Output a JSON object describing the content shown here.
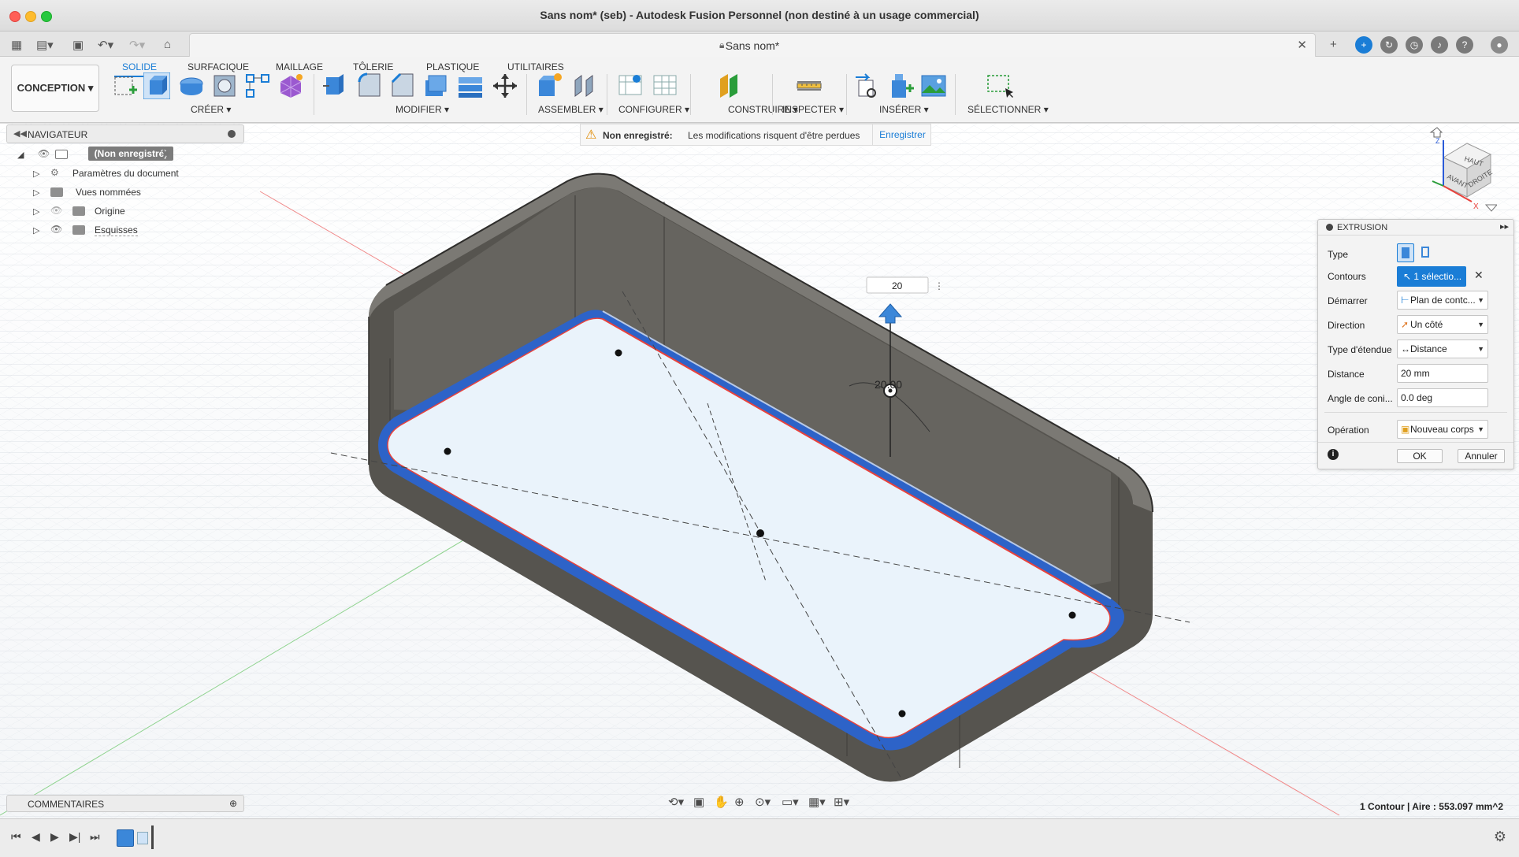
{
  "window": {
    "title": "Sans nom* (seb) - Autodesk Fusion Personnel (non destiné à un usage commercial)",
    "doc_tab": "Sans nom*"
  },
  "ribbon": {
    "workspace": "CONCEPTION",
    "tabs": [
      "SOLIDE",
      "SURFACIQUE",
      "MAILLAGE",
      "TÔLERIE",
      "PLASTIQUE",
      "UTILITAIRES"
    ],
    "active_tab": "SOLIDE",
    "groups": [
      "CRÉER",
      "MODIFIER",
      "ASSEMBLER",
      "CONFIGURER",
      "CONSTRUIRE",
      "INSPECTER",
      "INSÉRER",
      "SÉLECTIONNER"
    ]
  },
  "navigator": {
    "title": "NAVIGATEUR",
    "root": "(Non enregistré)",
    "items": [
      "Paramètres du document",
      "Vues nommées",
      "Origine",
      "Esquisses"
    ]
  },
  "warning": {
    "title": "Non enregistré:",
    "message": "Les modifications risquent d'être perdues",
    "action": "Enregistrer"
  },
  "viewport": {
    "distance_input": "20",
    "dimension_label": "20.00",
    "viewcube": {
      "top": "HAUT",
      "front": "AVANT",
      "right": "DROITE",
      "axis_x": "X",
      "axis_z": "Z"
    }
  },
  "extrusion": {
    "title": "EXTRUSION",
    "labels": {
      "type": "Type",
      "contours": "Contours",
      "start": "Démarrer",
      "direction": "Direction",
      "extent_type": "Type d'étendue",
      "distance": "Distance",
      "taper": "Angle de coni...",
      "operation": "Opération"
    },
    "values": {
      "contours": "1 sélectio...",
      "start": "Plan de contc...",
      "direction": "Un côté",
      "extent_type": "Distance",
      "distance": "20 mm",
      "taper": "0.0 deg",
      "operation": "Nouveau corps"
    },
    "ok": "OK",
    "cancel": "Annuler"
  },
  "comments": {
    "title": "COMMENTAIRES"
  },
  "status": "1 Contour | Aire : 553.097 mm^2",
  "colors": {
    "accent": "#1a7dd6",
    "body": "#5b5954",
    "profile_blue": "#2d63c8",
    "profile_red": "#e8423c"
  }
}
